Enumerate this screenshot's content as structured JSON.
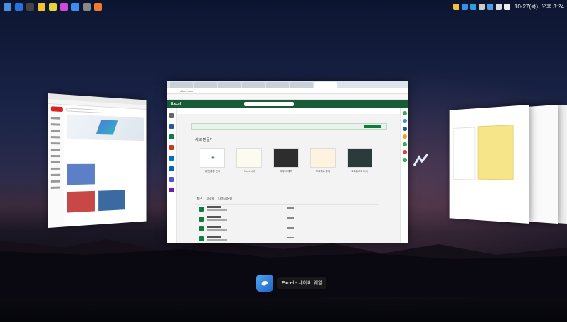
{
  "top_bar": {
    "clock": "10-27(목), 오후 3:24",
    "left_icons": [
      "app-icon-1",
      "app-icon-2",
      "app-icon-3",
      "app-icon-4",
      "app-icon-5",
      "app-icon-6",
      "app-icon-7",
      "app-icon-8",
      "app-icon-9"
    ],
    "tray_icons": [
      "tray-icon-1",
      "tray-icon-2",
      "tray-icon-3",
      "tray-icon-4",
      "tray-icon-5",
      "tray-icon-6",
      "tray-icon-7"
    ]
  },
  "center_window": {
    "address": "office.com",
    "app_title": "Excel",
    "new_section": "새로 만들기",
    "templates": [
      "새 빈 통합 문서",
      "Excel 시작",
      "재무 그래프",
      "프로젝트 추적",
      "포트폴리오 대시"
    ],
    "files_tabs": [
      "최근",
      "고정됨",
      "나와 공유됨"
    ]
  },
  "taskbar_label": {
    "app_name": "Excel - 네이버 웨일"
  },
  "colors": {
    "excel_green": "#185c37",
    "accent": "#107c41"
  }
}
